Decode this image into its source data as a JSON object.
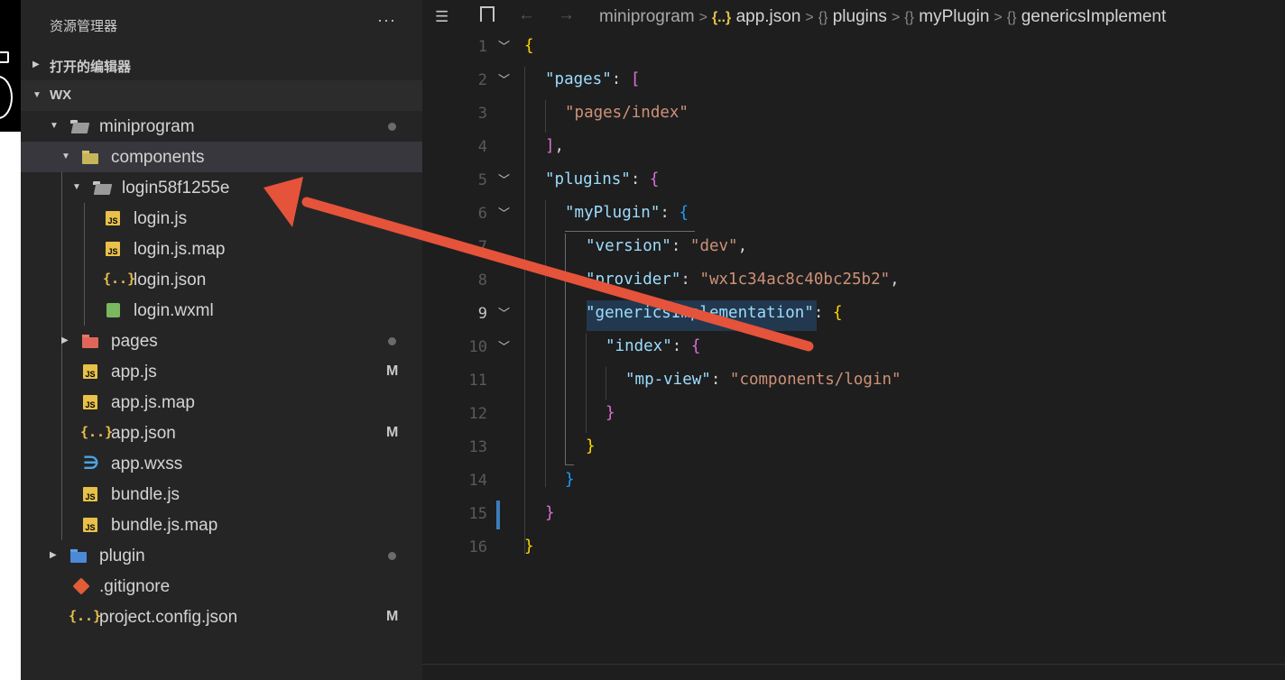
{
  "sidebar": {
    "title": "资源管理器",
    "more": "···",
    "sections": [
      {
        "label": "打开的编辑器",
        "expanded": false
      },
      {
        "label": "WX",
        "expanded": true
      }
    ],
    "tree": [
      {
        "name": "miniprogram",
        "indent": 0,
        "icon": "folder-open-icon",
        "twist": "▼",
        "status": "dot"
      },
      {
        "name": "components",
        "indent": 1,
        "icon": "components-folder-icon",
        "twist": "▼",
        "selected": true
      },
      {
        "name": "login58f1255e",
        "indent": 2,
        "icon": "folder-open-icon",
        "twist": "▼"
      },
      {
        "name": "login.js",
        "indent": 3,
        "icon": "js-file-icon"
      },
      {
        "name": "login.js.map",
        "indent": 3,
        "icon": "js-map-file-icon"
      },
      {
        "name": "login.json",
        "indent": 3,
        "icon": "json-file-icon"
      },
      {
        "name": "login.wxml",
        "indent": 3,
        "icon": "wxml-file-icon"
      },
      {
        "name": "pages",
        "indent": 1,
        "icon": "pages-folder-icon",
        "twist": "▶",
        "status": "dot"
      },
      {
        "name": "app.js",
        "indent": 1,
        "icon": "js-file-icon",
        "status": "M"
      },
      {
        "name": "app.js.map",
        "indent": 1,
        "icon": "js-map-file-icon"
      },
      {
        "name": "app.json",
        "indent": 1,
        "icon": "json-file-icon",
        "status": "M"
      },
      {
        "name": "app.wxss",
        "indent": 1,
        "icon": "css-file-icon"
      },
      {
        "name": "bundle.js",
        "indent": 1,
        "icon": "js-file-icon"
      },
      {
        "name": "bundle.js.map",
        "indent": 1,
        "icon": "js-map-file-icon"
      },
      {
        "name": "plugin",
        "indent": 0,
        "icon": "plugin-folder-icon",
        "twist": "▶",
        "status": "dot"
      },
      {
        "name": ".gitignore",
        "indent": 0,
        "icon": "git-file-icon"
      },
      {
        "name": "project.config.json",
        "indent": 0,
        "icon": "json-file-icon",
        "status": "M"
      }
    ]
  },
  "breadcrumb": {
    "items": [
      "miniprogram",
      "app.json",
      "plugins",
      "myPlugin",
      "genericsImplement"
    ],
    "json_icon": "{..}",
    "obj_icon": "{}"
  },
  "editor": {
    "active_line": 9,
    "line_numbers": [
      "1",
      "2",
      "3",
      "4",
      "5",
      "6",
      "7",
      "8",
      "9",
      "10",
      "11",
      "12",
      "13",
      "14",
      "15",
      "16"
    ],
    "tokens": {
      "l1_open": "{",
      "l2_key": "\"pages\"",
      "l2_colon": ": ",
      "l2_open": "[",
      "l3_val": "\"pages/index\"",
      "l4_close": "]",
      "l4_comma": ",",
      "l5_key": "\"plugins\"",
      "l5_colon": ": ",
      "l5_open": "{",
      "l6_key": "\"myPlugin\"",
      "l6_colon": ": ",
      "l6_open": "{",
      "l7_key": "\"version\"",
      "l7_colon": ": ",
      "l7_val": "\"dev\"",
      "l7_comma": ",",
      "l8_key": "\"provider\"",
      "l8_colon": ": ",
      "l8_val": "\"wx1c34ac8c40bc25b2\"",
      "l8_comma": ",",
      "l9_key": "\"genericsImplementation\"",
      "l9_colon": ": ",
      "l9_open": "{",
      "l10_key": "\"index\"",
      "l10_colon": ": ",
      "l10_open": "{",
      "l11_key": "\"mp-view\"",
      "l11_colon": ": ",
      "l11_val": "\"components/login\"",
      "l12_close": "}",
      "l13_close": "}",
      "l14_close": "}",
      "l15_close": "}",
      "l16_close": "}"
    }
  },
  "annotation": {
    "type": "arrow",
    "color": "#e5533b",
    "from": "genericsImplementation",
    "to": "login58f1255e"
  }
}
